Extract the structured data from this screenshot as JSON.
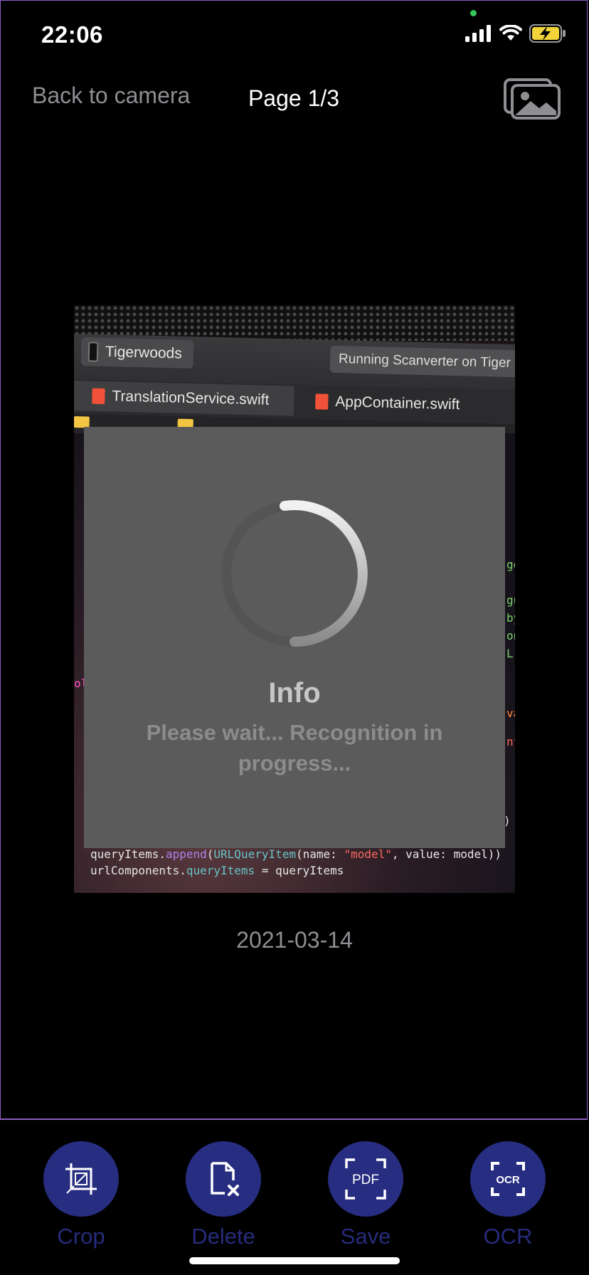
{
  "status_bar": {
    "time": "22:06"
  },
  "nav": {
    "back_label": "Back to camera",
    "page_label": "Page 1/3"
  },
  "document": {
    "scheme_label": "Tigerwoods",
    "running_label": "Running Scanverter on Tiger",
    "tabs": [
      "TranslationService.swift",
      "AppContainer.swift"
    ],
    "code_lines": [
      {
        "parts": [
          [
            "queryItems.",
            ""
          ],
          [
            "append",
            "c-purple"
          ],
          [
            "(",
            ""
          ],
          [
            "URLQueryItem",
            "c-teal"
          ],
          [
            "(name: ",
            ""
          ],
          [
            "\"model\"",
            "c-red"
          ],
          [
            ", value: model))",
            ""
          ]
        ]
      },
      {
        "parts": [
          [
            "urlComponents.",
            ""
          ],
          [
            "queryItems",
            "c-teal"
          ],
          [
            " = queryItems",
            ""
          ]
        ]
      }
    ]
  },
  "dialog": {
    "title": "Info",
    "message": "Please wait... Recognition in progress..."
  },
  "date": "2021-03-14",
  "toolbar": {
    "crop": "Crop",
    "delete": "Delete",
    "save": "Save",
    "ocr": "OCR",
    "pdf_icon_text": "PDF",
    "ocr_icon_text": "OCR"
  },
  "colors": {
    "accent": "#272d80",
    "frame": "#8a5fc0"
  },
  "icons": [
    "signal-icon",
    "wifi-icon",
    "battery-charging-icon",
    "gallery-icon",
    "crop-icon",
    "delete-file-icon",
    "pdf-scan-icon",
    "ocr-scan-icon"
  ]
}
